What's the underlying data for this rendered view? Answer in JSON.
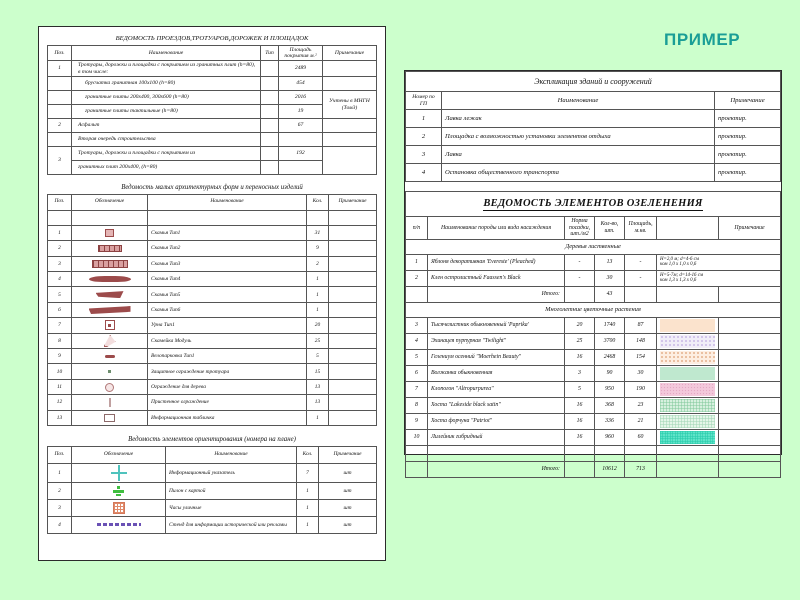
{
  "banner": {
    "example_label": "ПРИМЕР",
    "accent_color": "#1a9e96"
  },
  "background_color": "#ccffcc",
  "left_sheet": {
    "table_roads": {
      "title": "ВЕДОМОСТЬ ПРОЕЗДОВ,ТРОТУАРОВ,ДОРОЖЕК И ПЛОЩАДОК",
      "headers": [
        "Поз.",
        "Наименование",
        "Тип",
        "Площадь покрытия м.²",
        "Примечание"
      ],
      "rows": [
        {
          "pos": "1",
          "name": "Тротуары, дорожки и площадки с покрытием из гранитных плит  (h=80), в том числе:",
          "type": "",
          "area": "2489",
          "note": "",
          "indent": false
        },
        {
          "pos": "",
          "name": "брусчатка гранитная 100х100  (h=80)",
          "type": "",
          "area": "454",
          "note": "",
          "indent": true
        },
        {
          "pos": "",
          "name": "гранитные плиты  200х400, 300х600  (h=80)",
          "type": "",
          "area": "2016",
          "note": "",
          "indent": true
        },
        {
          "pos": "",
          "name": "гранитные плиты тактильные  (h=80)",
          "type": "",
          "area": "19",
          "note": "Учтены в МНГН (Том3)",
          "indent": true
        },
        {
          "pos": "2",
          "name": "Асфальт",
          "type": "",
          "area": "67",
          "note": "",
          "indent": false
        },
        {
          "pos": "",
          "name": "Вторая очередь строительства",
          "type": "",
          "area": "",
          "note": "",
          "indent": false
        },
        {
          "pos": "3",
          "name": "Тротуары, дорожки и площадки с покрытием из",
          "type": "",
          "area": "192",
          "note": "",
          "indent": false
        },
        {
          "pos": "",
          "name": "гранитных плит 200х400,  (h=80)",
          "type": "",
          "area": "",
          "note": "",
          "indent": false
        }
      ]
    },
    "table_forms": {
      "title": "Ведомость  малых архитектурных форм и переносных изделий",
      "headers": [
        "Поз.",
        "Обозначение",
        "Наименование",
        "Кол.",
        "Примечание"
      ],
      "rows": [
        {
          "pos": "1",
          "symbol": "bench-type1-icon",
          "name": "Скамья Тип1",
          "qty": "31",
          "note": ""
        },
        {
          "pos": "2",
          "symbol": "bench-type2-icon",
          "name": "Скамья Тип2",
          "qty": "9",
          "note": ""
        },
        {
          "pos": "3",
          "symbol": "bench-type3-icon",
          "name": "Скамья Тип3",
          "qty": "2",
          "note": ""
        },
        {
          "pos": "4",
          "symbol": "bench-type4-icon",
          "name": "Скамья Тип4",
          "qty": "1",
          "note": ""
        },
        {
          "pos": "5",
          "symbol": "bench-type5-icon",
          "name": "Скамья Тип5",
          "qty": "1",
          "note": ""
        },
        {
          "pos": "6",
          "symbol": "bench-type6-icon",
          "name": "Скамья Тип6",
          "qty": "1",
          "note": ""
        },
        {
          "pos": "7",
          "symbol": "urn-icon",
          "name": "Урна Тип1",
          "qty": "20",
          "note": ""
        },
        {
          "pos": "8",
          "symbol": "module-bench-icon",
          "name": "Скамейка Модуль",
          "qty": "25",
          "note": ""
        },
        {
          "pos": "9",
          "symbol": "bike-rack-icon",
          "name": "Велопарковка Тип1",
          "qty": "5",
          "note": ""
        },
        {
          "pos": "10",
          "symbol": "tree-guard-dot-icon",
          "name": "Защитное ограждение тротуара",
          "qty": "15",
          "note": ""
        },
        {
          "pos": "11",
          "symbol": "tree-ring-icon",
          "name": "Ограждение для дерева",
          "qty": "13",
          "note": ""
        },
        {
          "pos": "12",
          "symbol": "bollard-icon",
          "name": "Пристенное ограждение",
          "qty": "13",
          "note": ""
        },
        {
          "pos": "13",
          "symbol": "info-plate-icon",
          "name": "Информационная табличка",
          "qty": "1",
          "note": ""
        }
      ]
    },
    "table_orientation": {
      "title": "Ведомость элементов ориентирования (номера на плане)",
      "headers": [
        "Поз.",
        "Обозначение",
        "Наименование",
        "Кол.",
        "Примечание"
      ],
      "rows": [
        {
          "pos": "1",
          "symbol": "info-sign-cross-icon",
          "name": "Информационный указатель",
          "qty": "7",
          "note": "шт"
        },
        {
          "pos": "2",
          "symbol": "map-pylon-icon",
          "name": "Пилон с картой",
          "qty": "1",
          "note": "шт"
        },
        {
          "pos": "3",
          "symbol": "street-clock-icon",
          "name": "Часы уличные",
          "qty": "1",
          "note": "шт"
        },
        {
          "pos": "4",
          "symbol": "info-stand-icon",
          "name": "Стенд для информации исторической или рекламы",
          "qty": "1",
          "note": "шт"
        }
      ]
    }
  },
  "right_sheet": {
    "table_buildings": {
      "title": "Экспликация зданий и сооружений",
      "headers": [
        "Номер по ГП",
        "Наименование",
        "Примечание"
      ],
      "rows": [
        {
          "num": "1",
          "name": "Лавка лежак",
          "note": "проектир."
        },
        {
          "num": "2",
          "name": "Площадка с возможностью установки элементов отдыха",
          "note": "проектир."
        },
        {
          "num": "3",
          "name": "Лавка",
          "note": "проектир."
        },
        {
          "num": "4",
          "name": "Остановка общественного транспорта",
          "note": "проектир."
        }
      ]
    },
    "table_planting": {
      "title": "ВЕДОМОСТЬ ЭЛЕМЕНТОВ ОЗЕЛЕНЕНИЯ",
      "headers": [
        "п/п",
        "Наименование породы или вида насаждения",
        "Норма посадки, шт./м2",
        "Кол-во, шт.",
        "Площадь, м.кв.",
        "",
        "Примечание"
      ],
      "section_trees": "Деревья лиственные",
      "section_flowers": "Многолетние цветочные растения",
      "total_label": "Итого:",
      "trees": [
        {
          "pos": "1",
          "name": "Яблоня декоративная 'Evereste' (Pleached)",
          "norm": "-",
          "qty": "13",
          "area": "-",
          "swatch": "none",
          "note": "Н=2,0 м;  d=4-6 см\nком  1,0 х 1,0 х 0,6"
        },
        {
          "pos": "2",
          "name": "Клен остролистный Faassen's Black",
          "norm": "-",
          "qty": "30",
          "area": "-",
          "swatch": "none",
          "note": "Н=5-7м;  d=14-16 см\nком  1,3 х 1,3 х 0,6"
        }
      ],
      "trees_total": {
        "label": "Итого:",
        "qty": "43",
        "area": ""
      },
      "flowers": [
        {
          "pos": "3",
          "name": "Тысячелистник обыкновенный 'Paprika'",
          "norm": "20",
          "qty": "1740",
          "area": "87",
          "swatch": "sw1",
          "note": ""
        },
        {
          "pos": "4",
          "name": "Эхинацея пурпурная \"Twilight\"",
          "norm": "25",
          "qty": "3700",
          "area": "148",
          "swatch": "sw2",
          "note": ""
        },
        {
          "pos": "5",
          "name": "Гелениум осенний \"Moerhein Beauty\"",
          "norm": "16",
          "qty": "2468",
          "area": "154",
          "swatch": "sw3",
          "note": ""
        },
        {
          "pos": "6",
          "name": "Волжанка обыкновенная",
          "norm": "3",
          "qty": "90",
          "area": "30",
          "swatch": "sw4",
          "note": ""
        },
        {
          "pos": "7",
          "name": "Клопогон  \"Altropurpurea\"",
          "norm": "5",
          "qty": "950",
          "area": "190",
          "swatch": "sw5",
          "note": ""
        },
        {
          "pos": "8",
          "name": "Хоста \"Lakeside black satin\"",
          "norm": "16",
          "qty": "368",
          "area": "23",
          "swatch": "sw6",
          "note": ""
        },
        {
          "pos": "9",
          "name": "Хоста форчуна  \"Patriot\"",
          "norm": "16",
          "qty": "336",
          "area": "21",
          "swatch": "sw7",
          "note": ""
        },
        {
          "pos": "10",
          "name": "Лилейник гибридный",
          "norm": "16",
          "qty": "960",
          "area": "60",
          "swatch": "sw8",
          "note": ""
        }
      ],
      "grand_total": {
        "label": "Итого:",
        "norm": "",
        "qty": "10612",
        "area": "713",
        "note": ""
      }
    }
  }
}
